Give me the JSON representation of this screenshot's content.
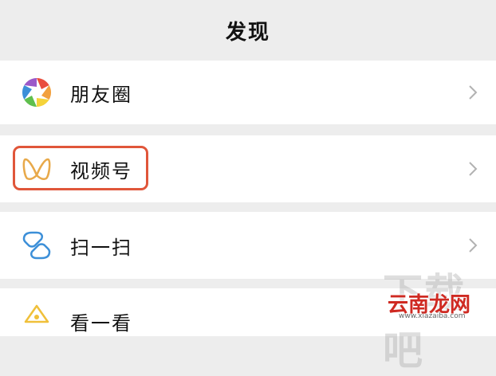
{
  "header": {
    "title": "发现"
  },
  "items": [
    {
      "label": "朋友圈",
      "icon": "moments-aperture-icon"
    },
    {
      "label": "视频号",
      "icon": "channels-butterfly-icon",
      "highlighted": true
    },
    {
      "label": "扫一扫",
      "icon": "scan-icon"
    },
    {
      "label": "看一看",
      "icon": "top-stories-icon"
    }
  ],
  "watermark": {
    "zh": "云南龙网",
    "big": "下载吧",
    "url": "www.xiazaiba.com"
  },
  "colors": {
    "background": "#ededed",
    "row": "#ffffff",
    "highlight": "#e0563a",
    "watermark": "#cf2a22"
  }
}
